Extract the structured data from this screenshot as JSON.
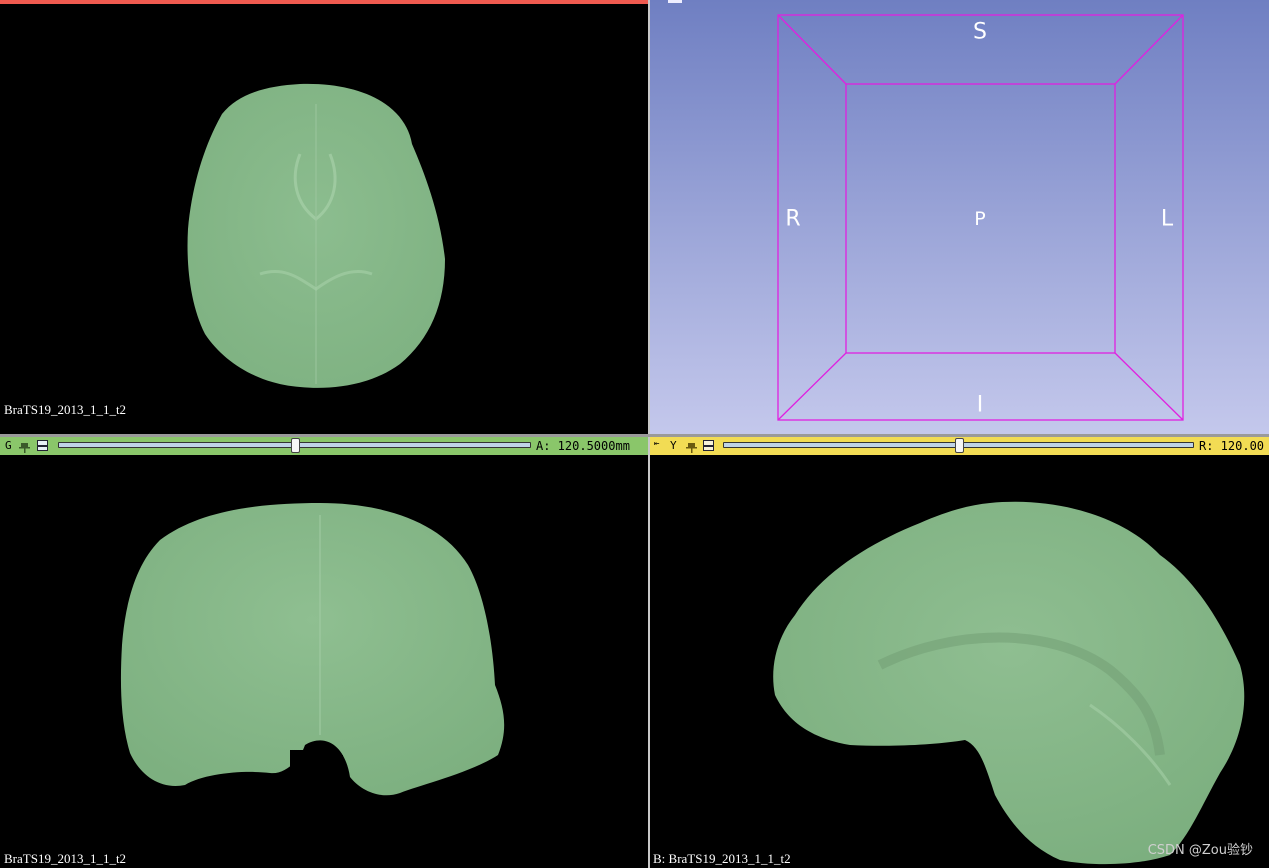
{
  "colors": {
    "red_bar": "#ef5a4f",
    "green_bar": "#8ac66a",
    "yellow_bar": "#f2dc54",
    "tissue": "#86b889",
    "threed_top": "#6f7fc2",
    "threed_bottom": "#c4c8ec",
    "bbox": "#e020e0"
  },
  "red_view": {
    "label": "BraTS19_2013_1_1_t2"
  },
  "three_d_view": {
    "orient_superior": "S",
    "orient_inferior": "I",
    "orient_right": "R",
    "orient_left": "L",
    "orient_posterior": "P"
  },
  "green_view": {
    "bar_letter": "G",
    "pin_icon": "pin-icon",
    "maximize_icon": "maximize-view-icon",
    "slice_value": "A: 120.5000mm",
    "slider_position": 0.5,
    "label": "BraTS19_2013_1_1_t2"
  },
  "yellow_view": {
    "bar_letter": "Y",
    "pin_icon": "pin-icon",
    "maximize_icon": "maximize-view-icon",
    "slice_value": "R: 120.00",
    "slider_position": 0.5,
    "label": "B: BraTS19_2013_1_1_t2"
  },
  "watermark": "CSDN @Zou验钞"
}
